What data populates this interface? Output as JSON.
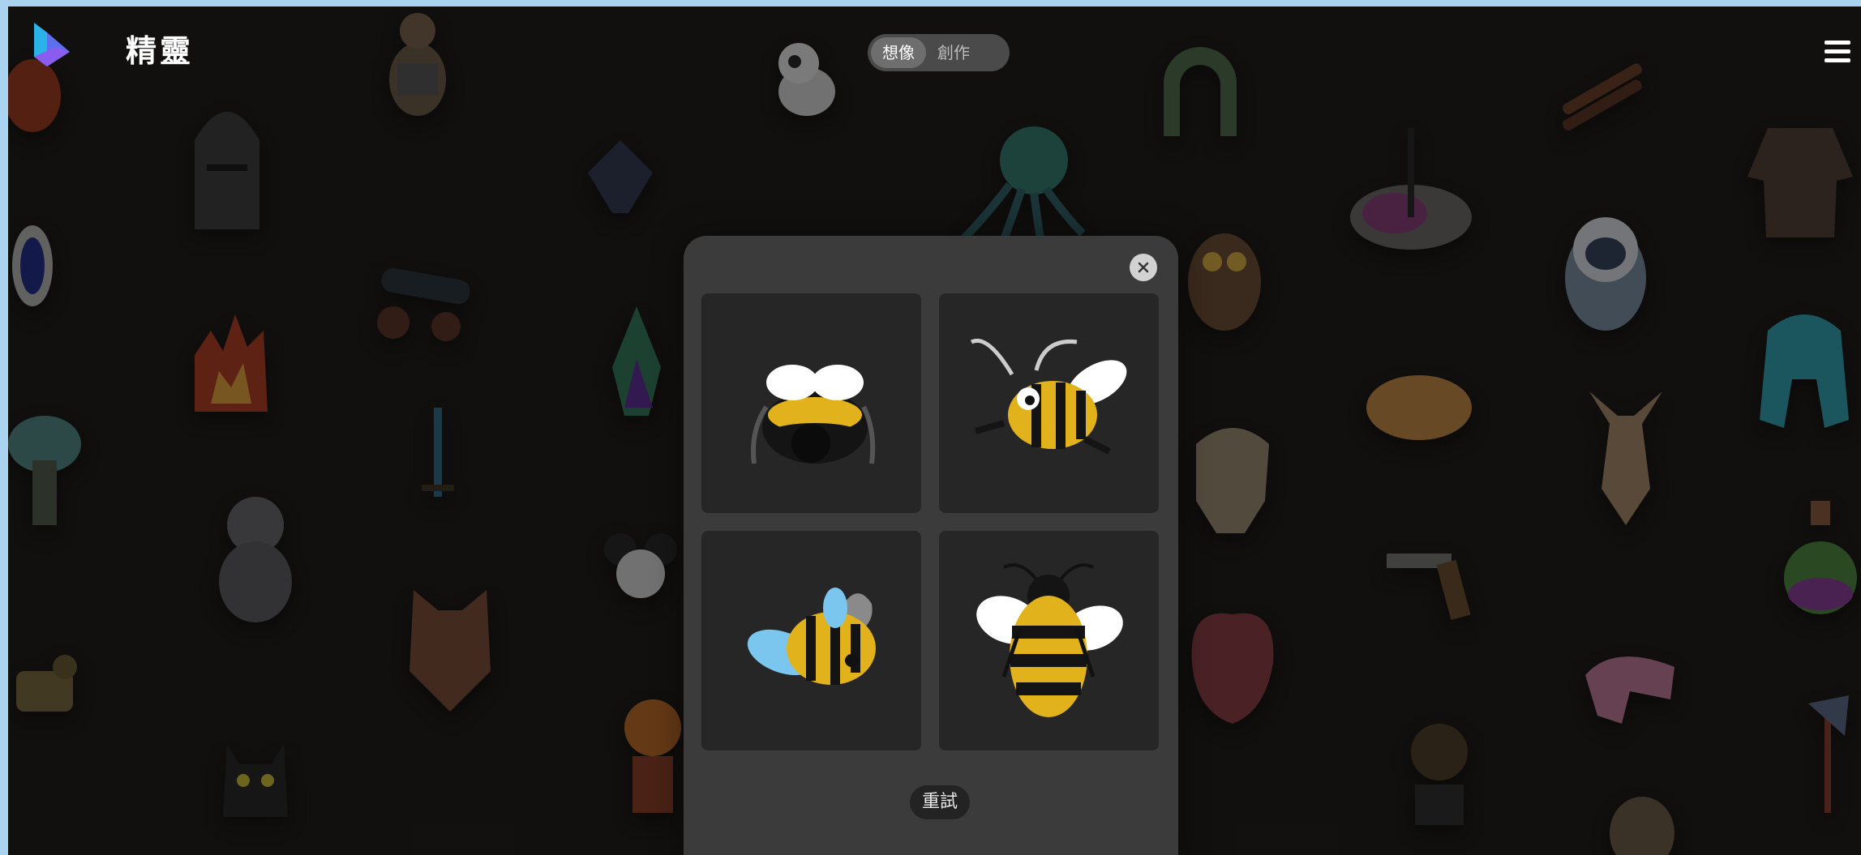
{
  "app": {
    "title": "精靈"
  },
  "header": {
    "modes": [
      {
        "label": "想像",
        "active": true
      },
      {
        "label": "創作",
        "active": false
      }
    ]
  },
  "modal": {
    "retry_label": "重試",
    "results": [
      {
        "name": "bee-result-1",
        "icon": "bee-hat"
      },
      {
        "name": "bee-result-2",
        "icon": "cartoon-bee"
      },
      {
        "name": "bee-result-3",
        "icon": "plush-bee"
      },
      {
        "name": "bee-result-4",
        "icon": "realistic-bee"
      }
    ]
  },
  "colors": {
    "background": "#161412",
    "frame": "#a9d3ee",
    "modal": "#3b3b3b",
    "card": "#262626",
    "toggle": "#4a4a4a",
    "bee_yellow": "#e1b21b",
    "bee_black": "#141414"
  }
}
